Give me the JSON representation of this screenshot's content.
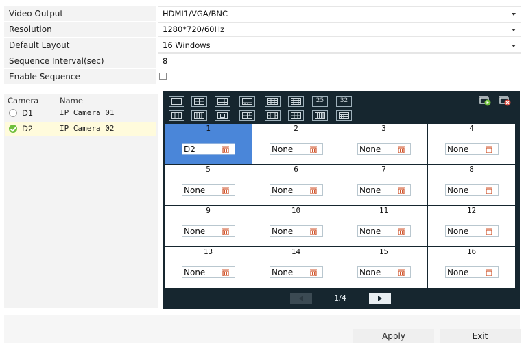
{
  "settings": {
    "video_output": {
      "label": "Video Output",
      "value": "HDMI1/VGA/BNC"
    },
    "resolution": {
      "label": "Resolution",
      "value": "1280*720/60Hz"
    },
    "default_layout": {
      "label": "Default Layout",
      "value": "16 Windows"
    },
    "sequence_interval": {
      "label": "Sequence Interval(sec)",
      "value": "8"
    },
    "enable_sequence": {
      "label": "Enable Sequence",
      "checked": false
    }
  },
  "camera_list": {
    "headers": {
      "camera": "Camera",
      "name": "Name"
    },
    "rows": [
      {
        "id": "D1",
        "name": "IP Camera 01",
        "selected": false
      },
      {
        "id": "D2",
        "name": "IP Camera 02",
        "selected": true
      }
    ]
  },
  "layout_buttons": {
    "row1": [
      "1",
      "4",
      "6",
      "8",
      "9",
      "13",
      "25",
      "32"
    ],
    "row2": [
      "layout-a",
      "layout-b",
      "layout-c",
      "layout-d",
      "layout-e",
      "layout-f",
      "layout-g",
      "layout-h"
    ],
    "label_25": "25",
    "label_32": "32"
  },
  "windows": [
    {
      "num": "1",
      "value": "D2",
      "selected": true
    },
    {
      "num": "2",
      "value": "None"
    },
    {
      "num": "3",
      "value": "None"
    },
    {
      "num": "4",
      "value": "None"
    },
    {
      "num": "5",
      "value": "None"
    },
    {
      "num": "6",
      "value": "None"
    },
    {
      "num": "7",
      "value": "None"
    },
    {
      "num": "8",
      "value": "None"
    },
    {
      "num": "9",
      "value": "None"
    },
    {
      "num": "10",
      "value": "None"
    },
    {
      "num": "11",
      "value": "None"
    },
    {
      "num": "12",
      "value": "None"
    },
    {
      "num": "13",
      "value": "None"
    },
    {
      "num": "14",
      "value": "None"
    },
    {
      "num": "15",
      "value": "None"
    },
    {
      "num": "16",
      "value": "None"
    }
  ],
  "pager": {
    "text": "1/4"
  },
  "footer": {
    "apply": "Apply",
    "exit": "Exit"
  },
  "colors": {
    "panel_bg": "#16262f",
    "selected_cell": "#4a86d9",
    "trash": "#d0572f",
    "check_green": "#6fbf3b"
  }
}
